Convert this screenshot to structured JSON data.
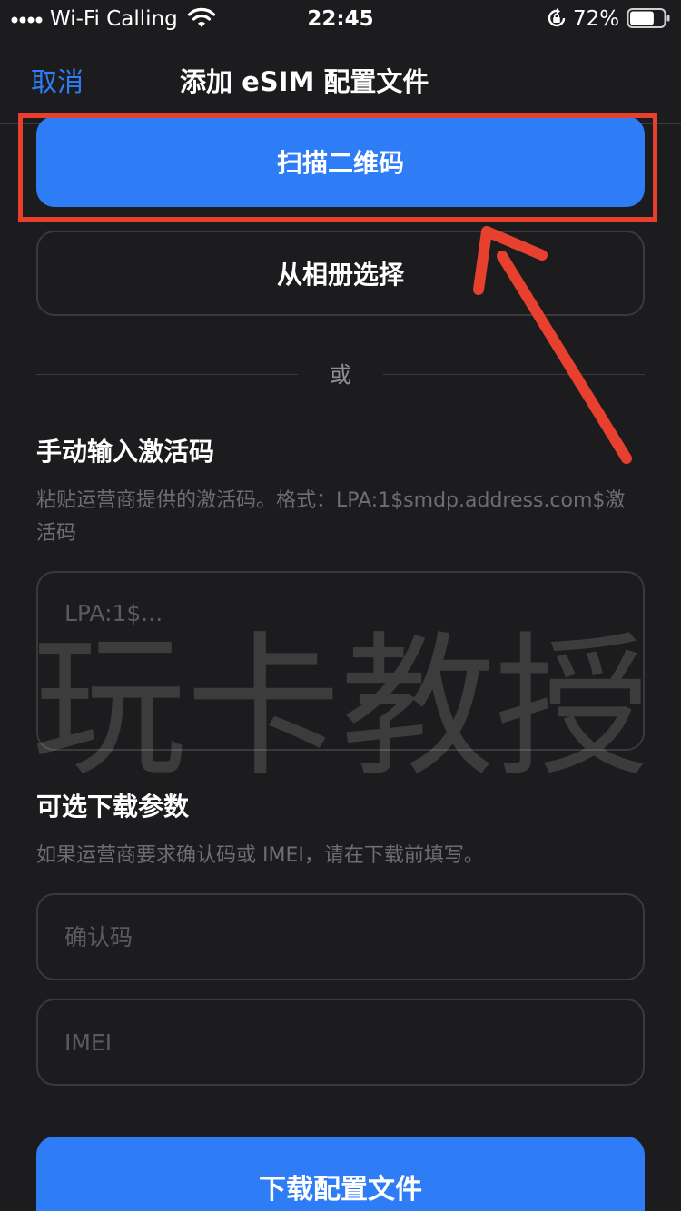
{
  "status_bar": {
    "carrier": "Wi-Fi Calling",
    "time": "22:45",
    "battery_percent": "72%",
    "battery_level": 0.72,
    "icons": [
      "signal-dots-icon",
      "wifi-icon",
      "orientation-lock-icon",
      "battery-icon"
    ]
  },
  "nav": {
    "cancel_label": "取消",
    "title": "添加 eSIM 配置文件"
  },
  "actions": {
    "scan_label": "扫描二维码",
    "album_label": "从相册选择",
    "divider_label": "或"
  },
  "manual": {
    "title": "手动输入激活码",
    "help": "粘贴运营商提供的激活码。格式：LPA:1$smdp.address.com$激活码",
    "placeholder": "LPA:1$..."
  },
  "optional": {
    "title": "可选下载参数",
    "help": "如果运营商要求确认码或 IMEI，请在下载前填写。",
    "confirm_placeholder": "确认码",
    "imei_placeholder": "IMEI"
  },
  "download_label": "下载配置文件",
  "watermark": "玩卡教授",
  "colors": {
    "accent": "#2f7df6",
    "background": "#1c1c1e",
    "annotation": "#e8402f"
  }
}
